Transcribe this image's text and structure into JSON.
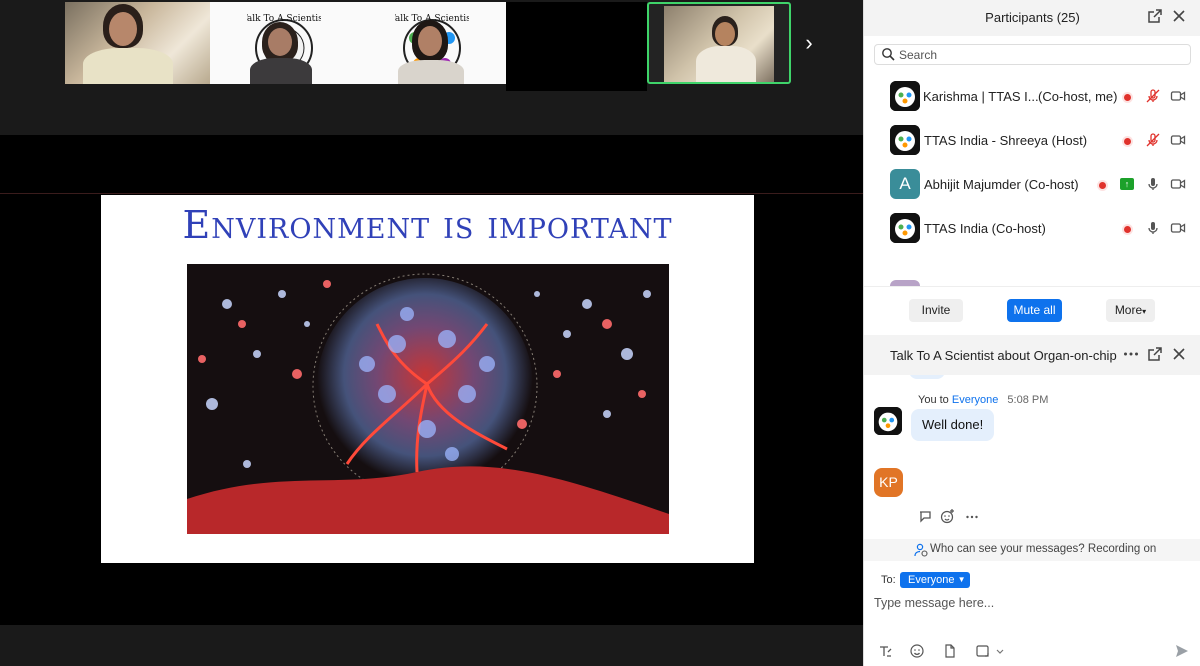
{
  "participants_panel": {
    "title": "Participants (25)",
    "search_placeholder": "Search",
    "participants": [
      {
        "name": "Karishma | TTAS I...",
        "role": "(Co-host, me)",
        "avatar": "ttas-logo",
        "audio": "muted",
        "video": "on"
      },
      {
        "name": "TTAS India - Shreeya (Host)",
        "role": "",
        "avatar": "ttas-logo",
        "audio": "muted",
        "video": "on"
      },
      {
        "name": "Abhijit Majumder (Co-host)",
        "role": "",
        "avatar": "A",
        "audio": "mic",
        "video": "on",
        "sharing": true
      },
      {
        "name": "TTAS India (Co-host)",
        "role": "",
        "avatar": "ttas-logo",
        "audio": "mic",
        "video": "on"
      }
    ],
    "buttons": {
      "invite": "Invite",
      "mute_all": "Mute all",
      "more": "More"
    }
  },
  "chat": {
    "title": "Talk To A Scientist about Organ-on-chip",
    "message": {
      "sender": "You",
      "to_word": "to",
      "recipient": "Everyone",
      "time": "5:08 PM",
      "text": "Well done!"
    },
    "next_avatar_initials": "KP",
    "notice": "Who can see your messages? Recording on",
    "to_label": "To:",
    "to_value": "Everyone",
    "input_placeholder": "Type message here..."
  },
  "shared_screen": {
    "slide_title": "Environment is important"
  },
  "colors": {
    "accent": "#0e72ed",
    "active_speaker_border": "#3fd46a",
    "slide_title": "#3041b8",
    "recording": "#e0322c",
    "kp_avatar": "#e17526",
    "letter_avatar": "#3a8d99"
  }
}
